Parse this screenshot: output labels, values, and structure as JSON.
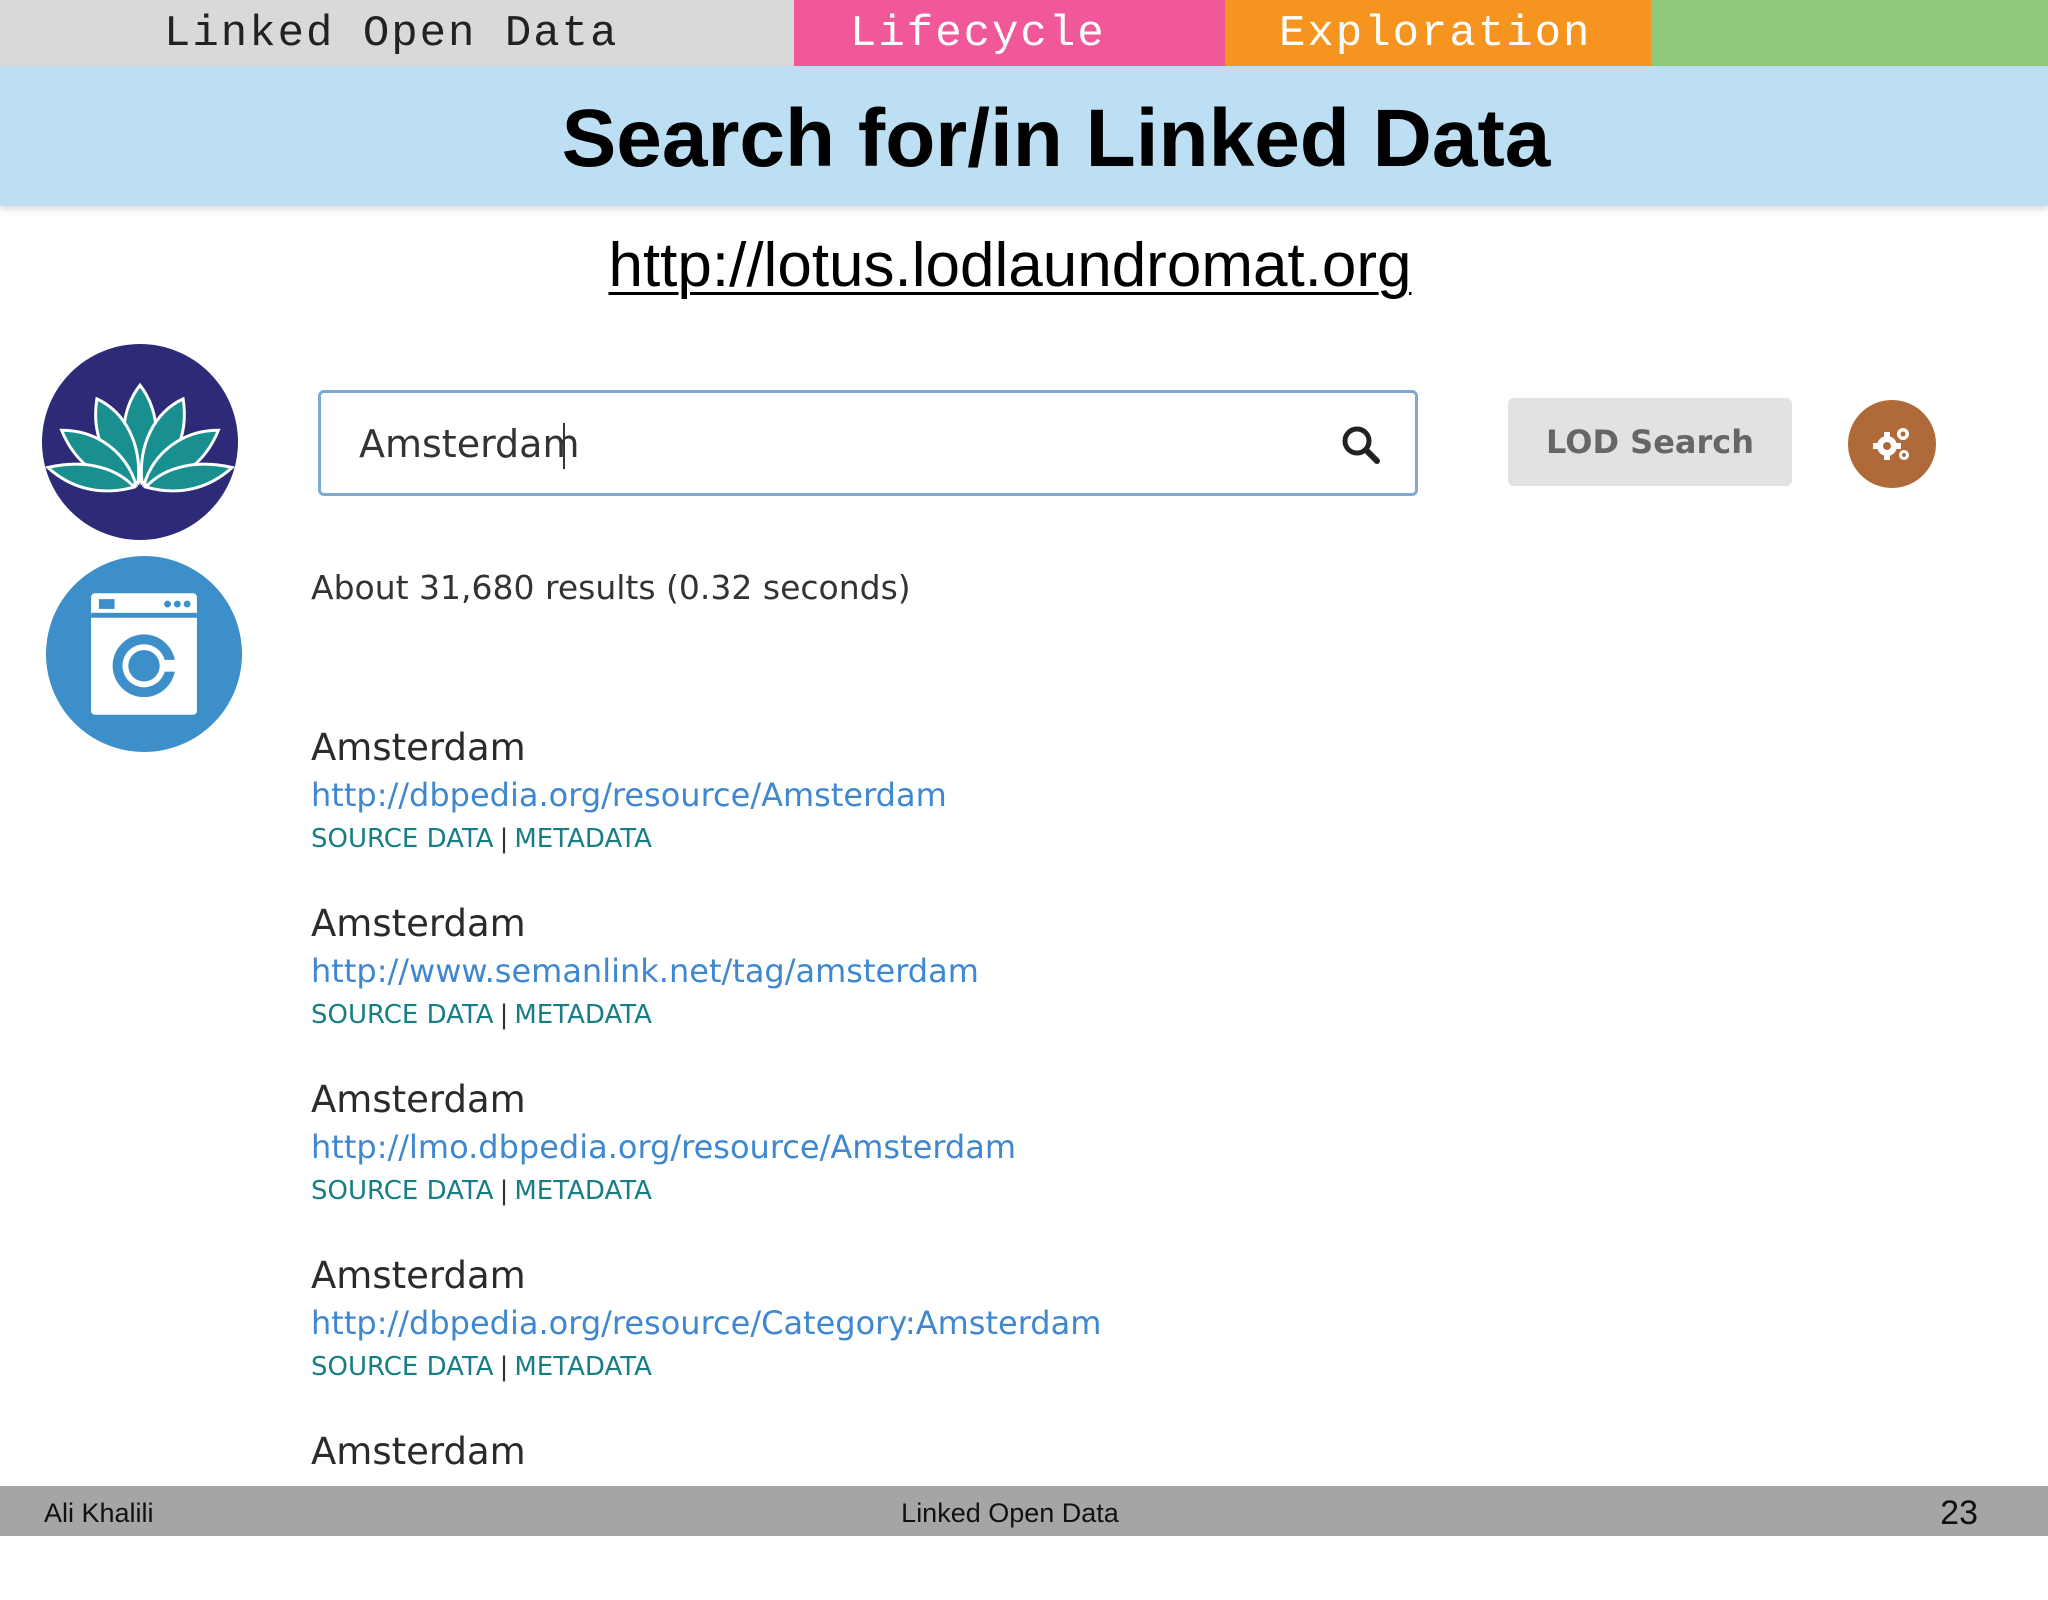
{
  "tabs": [
    {
      "label": "Linked Open Data",
      "color": "#d9d9d9"
    },
    {
      "label": "Lifecycle",
      "color": "#f0589a"
    },
    {
      "label": "Exploration",
      "color": "#f5951f"
    },
    {
      "label": "",
      "color": "#90c97c"
    }
  ],
  "slide": {
    "title": "Search for/in Linked Data",
    "url": "http://lotus.lodlaundromat.org"
  },
  "logos": {
    "lotus": "lotus-logo-icon",
    "laundromat": "washing-machine-logo-icon"
  },
  "search": {
    "query": "Amsterdam",
    "button_label": "LOD Search",
    "settings_icon": "gears-icon",
    "search_icon": "magnifier-icon"
  },
  "results_summary": "About 31,680 results (0.32 seconds)",
  "results": [
    {
      "title": "Amsterdam",
      "url": "http://dbpedia.org/resource/Amsterdam",
      "source_label": "SOURCE DATA",
      "meta_label": "METADATA"
    },
    {
      "title": "Amsterdam",
      "url": "http://www.semanlink.net/tag/amsterdam",
      "source_label": "SOURCE DATA",
      "meta_label": "METADATA"
    },
    {
      "title": "Amsterdam",
      "url": "http://lmo.dbpedia.org/resource/Amsterdam",
      "source_label": "SOURCE DATA",
      "meta_label": "METADATA"
    },
    {
      "title": "Amsterdam",
      "url": "http://dbpedia.org/resource/Category:Amsterdam",
      "source_label": "SOURCE DATA",
      "meta_label": "METADATA"
    },
    {
      "title": "Amsterdam"
    }
  ],
  "footer": {
    "author": "Ali Khalili",
    "center": "Linked Open Data",
    "page": "23"
  },
  "colors": {
    "title_band": "#bcdff3",
    "link_blue": "#3f88cf",
    "link_teal": "#177e85",
    "settings_button": "#b06a3a",
    "lotus_bg": "#2d2a77",
    "washer_bg": "#3d8fc9",
    "footer_bg": "#a4a5a6"
  }
}
